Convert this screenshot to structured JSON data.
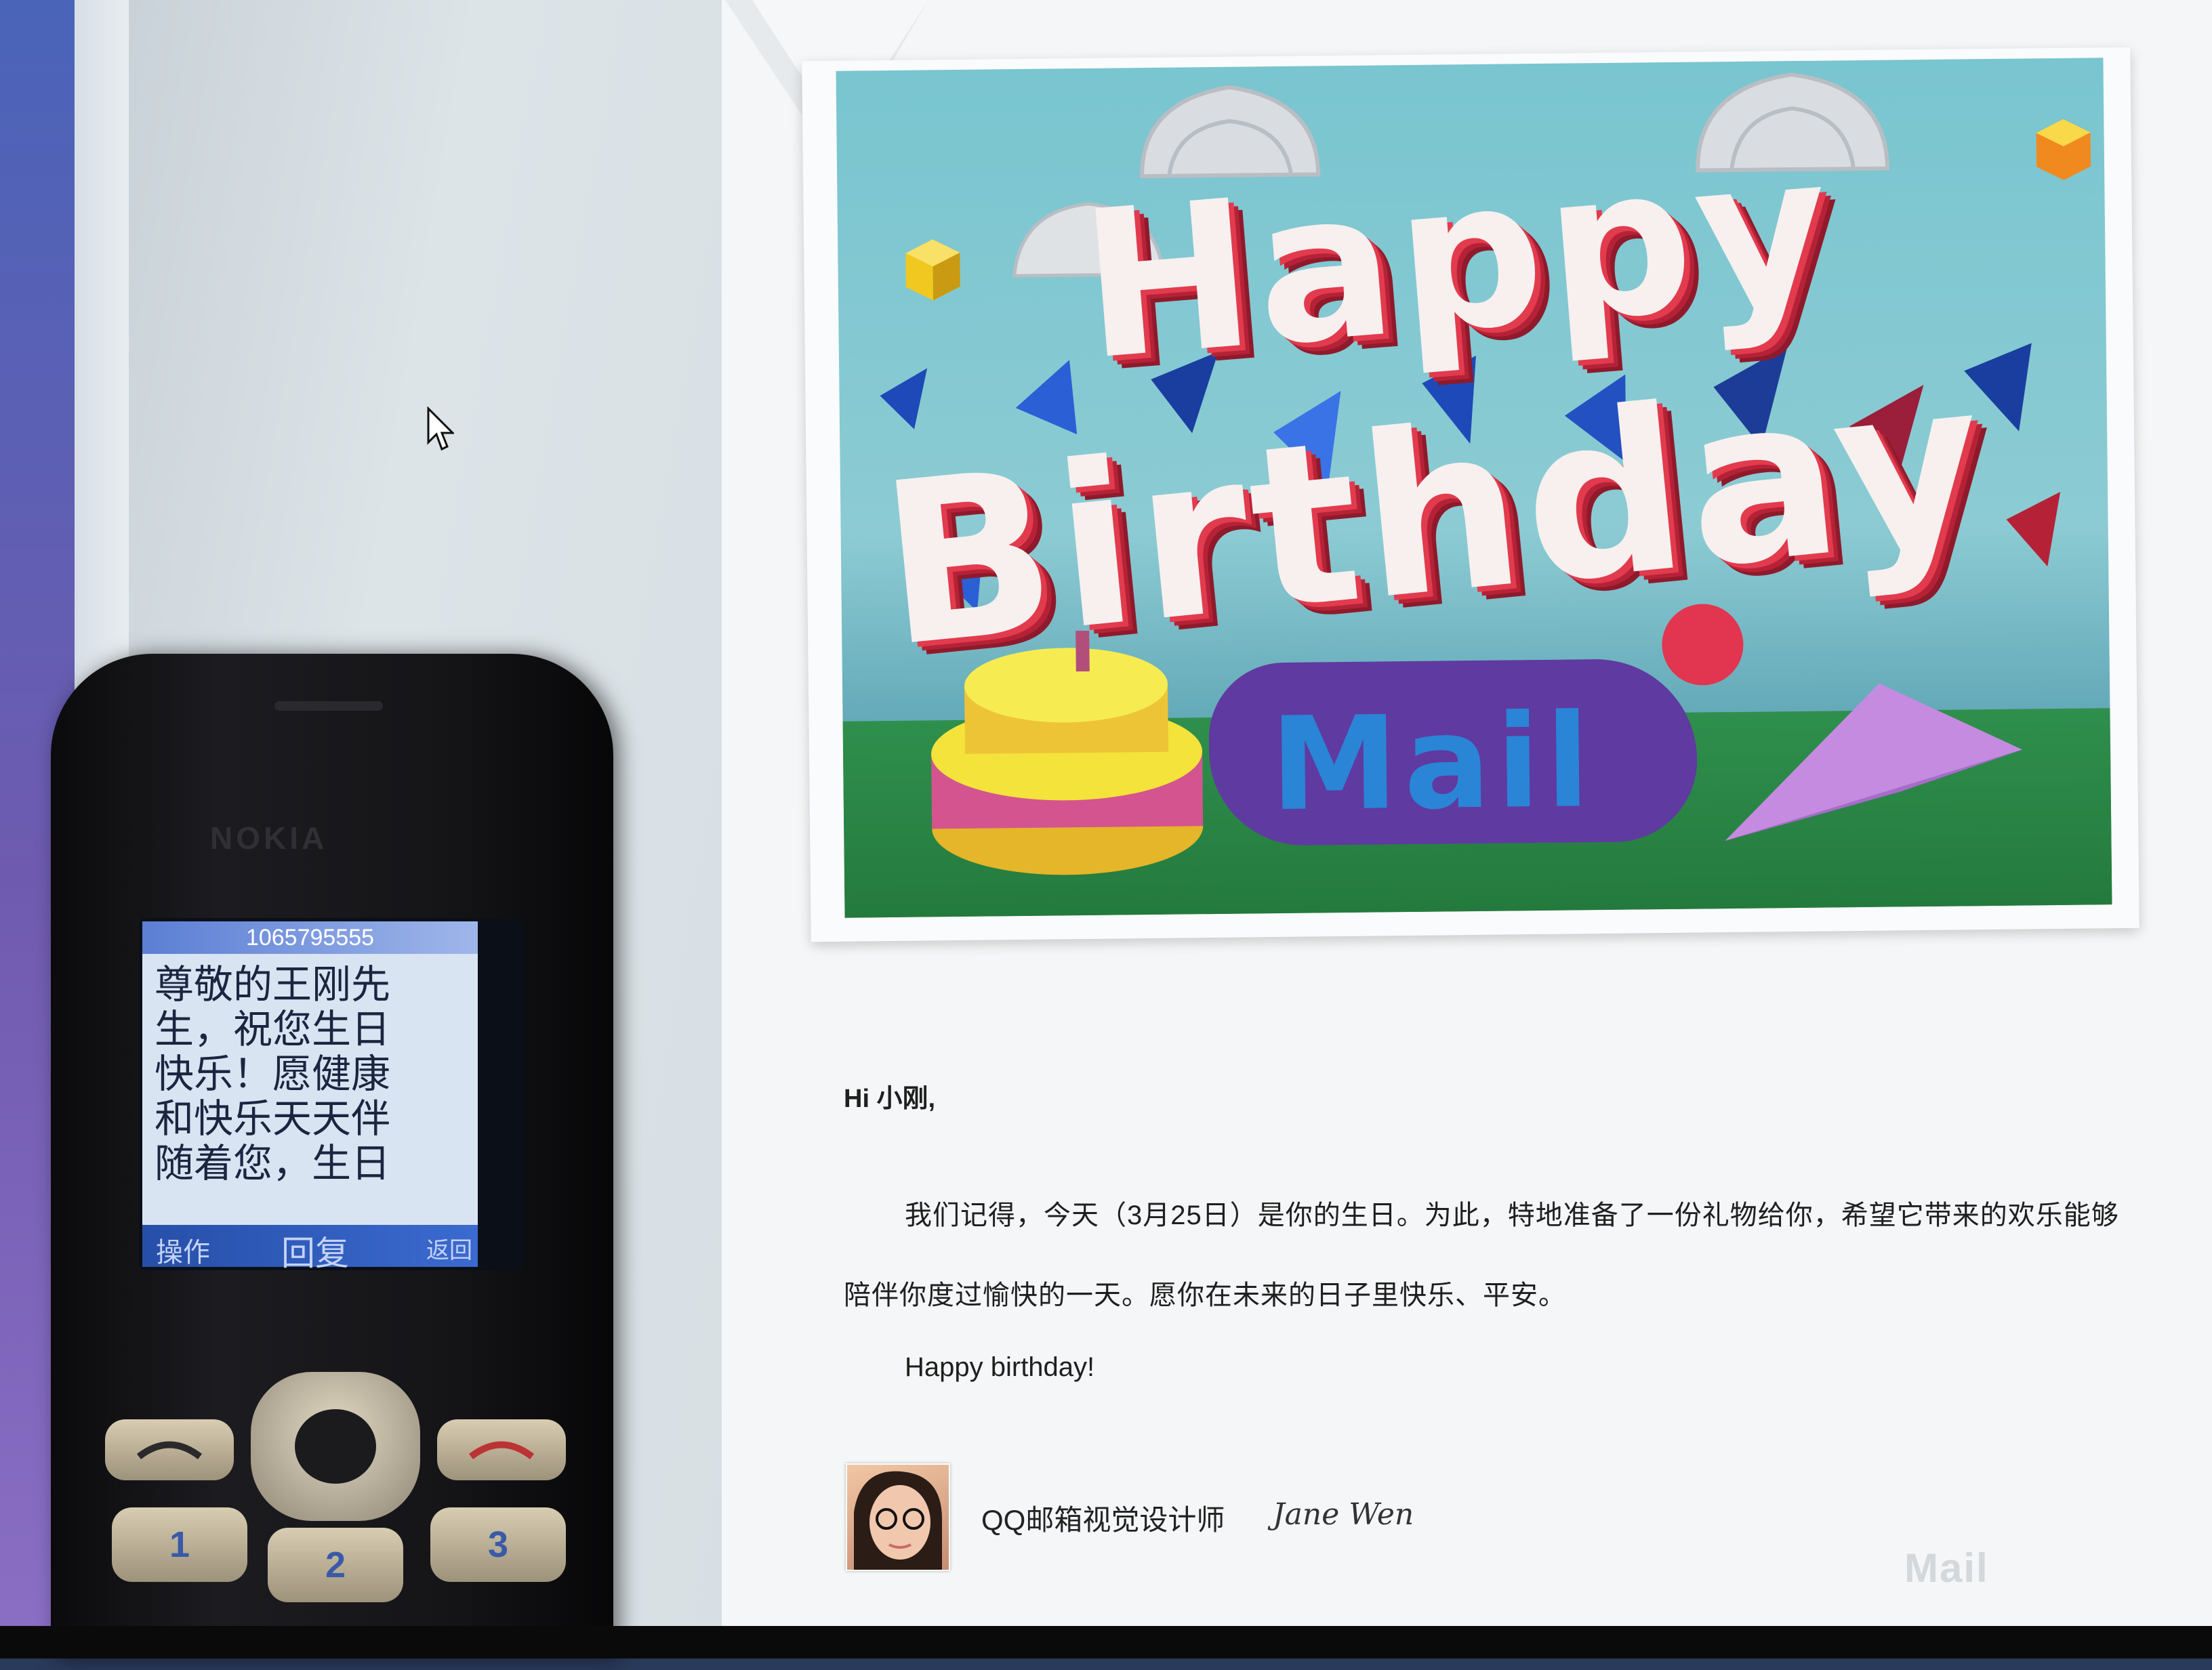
{
  "card": {
    "headline_line1": "Happy",
    "headline_line2": "Birthday",
    "logo_text": "Mail"
  },
  "letter": {
    "greeting": "Hi 小刚,",
    "paragraph": "我们记得，今天（3月25日）是你的生日。为此，特地准备了一份礼物给你，希望它带来的欢乐能够陪伴你度过愉快的一天。愿你在未来的日子里快乐、平安。",
    "closing": "Happy birthday!",
    "signature_title": "QQ邮箱视觉设计师",
    "signature_name": "Jane Wen",
    "brand_mark": "Mail"
  },
  "phone": {
    "brand": "NOKIA",
    "sender_number": "1065795555",
    "sms_text": "尊敬的王刚先\n生，祝您生日\n快乐！愿健康\n和快乐天天伴\n随着您，生日",
    "softkey_left": "操作",
    "softkey_middle": "回复",
    "softkey_right": "返回",
    "key_1": "1",
    "key_2": "2",
    "key_3": "3"
  },
  "colors": {
    "card_sky": "#79c5d0",
    "grass": "#2f8f4d",
    "letter_red": "#e23b4e",
    "phone_screen": "#d9e4f3",
    "softkey_bar": "#264fa8"
  }
}
